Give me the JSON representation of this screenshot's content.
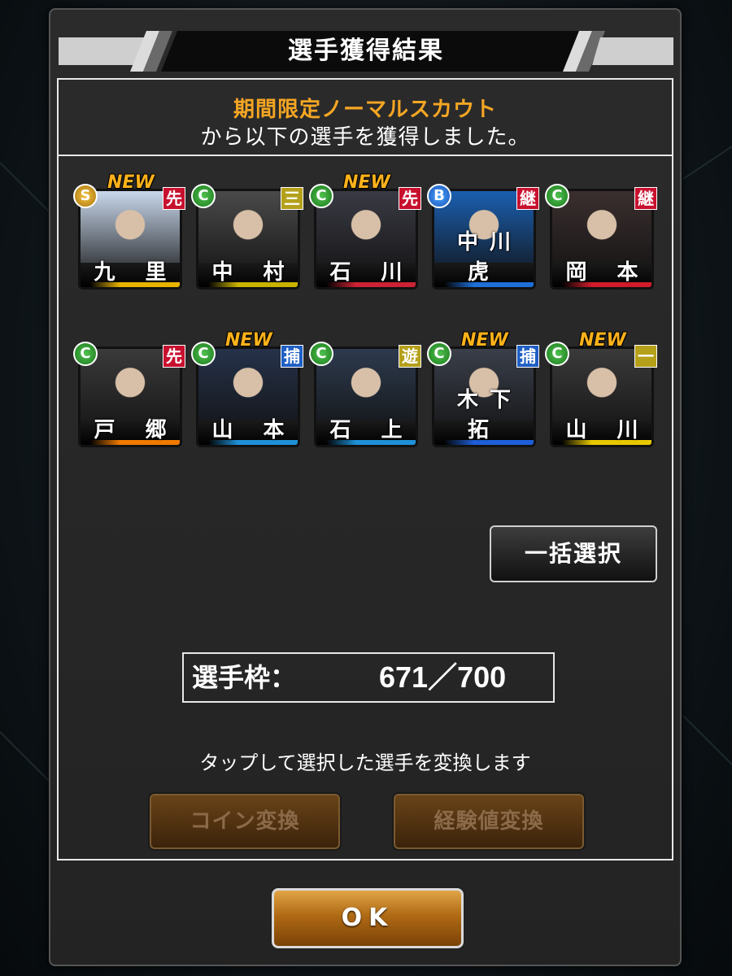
{
  "dialog": {
    "title": "選手獲得結果",
    "scout_name": "期間限定ノーマルスカウト",
    "scout_message": "から以下の選手を獲得しました。"
  },
  "players": [
    {
      "name": "九 里",
      "rank": "S",
      "position": "先",
      "position_color": "red",
      "is_new": true,
      "new_label": "NEW",
      "team_color": "#e8b400",
      "photo_color": "#c9d8ec"
    },
    {
      "name": "中 村",
      "rank": "C",
      "position": "三",
      "position_color": "yellow",
      "is_new": false,
      "new_label": "",
      "team_color": "#c9b200",
      "photo_color": "#4a4a4a"
    },
    {
      "name": "石 川",
      "rank": "C",
      "position": "先",
      "position_color": "red",
      "is_new": true,
      "new_label": "NEW",
      "team_color": "#cc2233",
      "photo_color": "#3a3a44"
    },
    {
      "name": "中川虎",
      "rank": "B",
      "position": "継",
      "position_color": "red",
      "is_new": false,
      "new_label": "",
      "team_color": "#1e6fd8",
      "photo_color": "#1b5fb0"
    },
    {
      "name": "岡 本",
      "rank": "C",
      "position": "継",
      "position_color": "red",
      "is_new": false,
      "new_label": "",
      "team_color": "#d01c2a",
      "photo_color": "#3b2f2f"
    },
    {
      "name": "戸 郷",
      "rank": "C",
      "position": "先",
      "position_color": "red",
      "is_new": false,
      "new_label": "",
      "team_color": "#f07a00",
      "photo_color": "#3a3a3a"
    },
    {
      "name": "山 本",
      "rank": "C",
      "position": "捕",
      "position_color": "blue",
      "is_new": true,
      "new_label": "NEW",
      "team_color": "#1e90d8",
      "photo_color": "#26324a"
    },
    {
      "name": "石 上",
      "rank": "C",
      "position": "遊",
      "position_color": "yellow",
      "is_new": false,
      "new_label": "",
      "team_color": "#1e90d8",
      "photo_color": "#2d3a4e"
    },
    {
      "name": "木下拓",
      "rank": "C",
      "position": "捕",
      "position_color": "blue",
      "is_new": true,
      "new_label": "NEW",
      "team_color": "#1e5fd8",
      "photo_color": "#3a3f4a"
    },
    {
      "name": "山 川",
      "rank": "C",
      "position": "一",
      "position_color": "yellow",
      "is_new": true,
      "new_label": "NEW",
      "team_color": "#e8c800",
      "photo_color": "#3a3a3a"
    }
  ],
  "bulk_select_label": "一括選択",
  "roster": {
    "label": "選手枠：",
    "value": "671／700"
  },
  "hint": "タップして選択した選手を変換します",
  "buttons": {
    "coin_convert": "コイン変換",
    "exp_convert": "経験値変換",
    "ok": "OK"
  }
}
